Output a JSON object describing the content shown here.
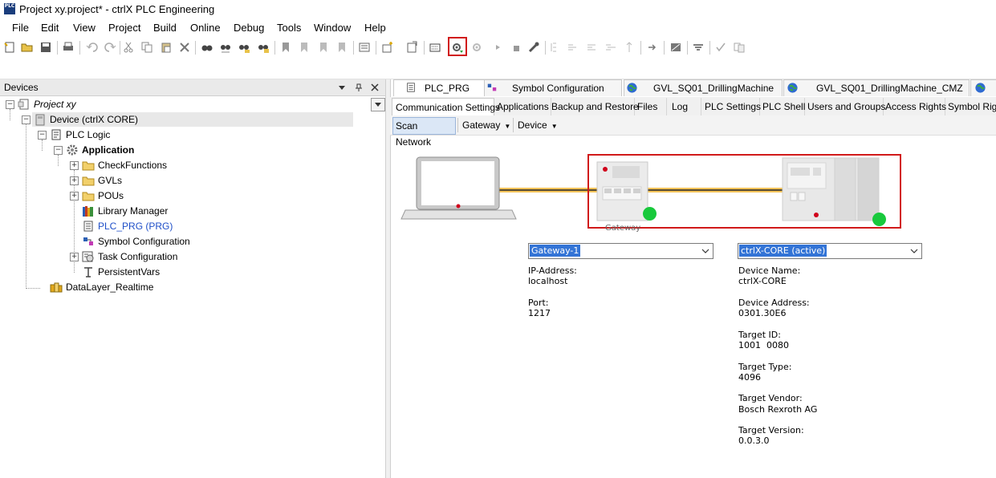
{
  "window": {
    "title": "Project xy.project* - ctrlX PLC Engineering",
    "logo_text": "PLC"
  },
  "menu": [
    "File",
    "Edit",
    "View",
    "Project",
    "Build",
    "Online",
    "Debug",
    "Tools",
    "Window",
    "Help"
  ],
  "devices_panel": {
    "title": "Devices",
    "tree": {
      "project": "Project xy",
      "device": "Device (ctrlX CORE)",
      "plc_logic": "PLC Logic",
      "application": "Application",
      "check_functions": "CheckFunctions",
      "gvls": "GVLs",
      "pous": "POUs",
      "library_manager": "Library Manager",
      "plc_prg": "PLC_PRG (PRG)",
      "symbol_configuration": "Symbol Configuration",
      "task_configuration": "Task Configuration",
      "persistent_vars": "PersistentVars",
      "datalayer_realtime": "DataLayer_Realtime"
    }
  },
  "editor_tabs": [
    "PLC_PRG",
    "Symbol Configuration",
    "GVL_SQ01_DrillingMachine",
    "GVL_SQ01_DrillingMachine_CMZ"
  ],
  "sub_tabs": [
    "Communication Settings",
    "Applications",
    "Backup and Restore",
    "Files",
    "Log",
    "PLC Settings",
    "PLC Shell",
    "Users and Groups",
    "Access Rights",
    "Symbol Rights"
  ],
  "scan_bar": {
    "scan_network": "Scan Network",
    "gateway": "Gateway",
    "device": "Device"
  },
  "diagram": {
    "gateway_caption": "Gateway",
    "status_color": "#18c93c",
    "highlight_color": "#d11a1a"
  },
  "gateway_info": {
    "selected": "Gateway-1",
    "ip_label": "IP-Address:",
    "ip_value": "localhost",
    "port_label": "Port:",
    "port_value": "1217"
  },
  "device_info": {
    "selected": "ctrlX-CORE (active)",
    "fields": [
      {
        "label": "Device Name:",
        "value": "ctrlX-CORE"
      },
      {
        "label": "Device Address:",
        "value": "0301.30E6"
      },
      {
        "label": "Target ID:",
        "value": "1001  0080"
      },
      {
        "label": "Target Type:",
        "value": "4096"
      },
      {
        "label": "Target Vendor:",
        "value": "Bosch Rexroth AG"
      },
      {
        "label": "Target Version:",
        "value": "0.0.3.0"
      }
    ]
  }
}
